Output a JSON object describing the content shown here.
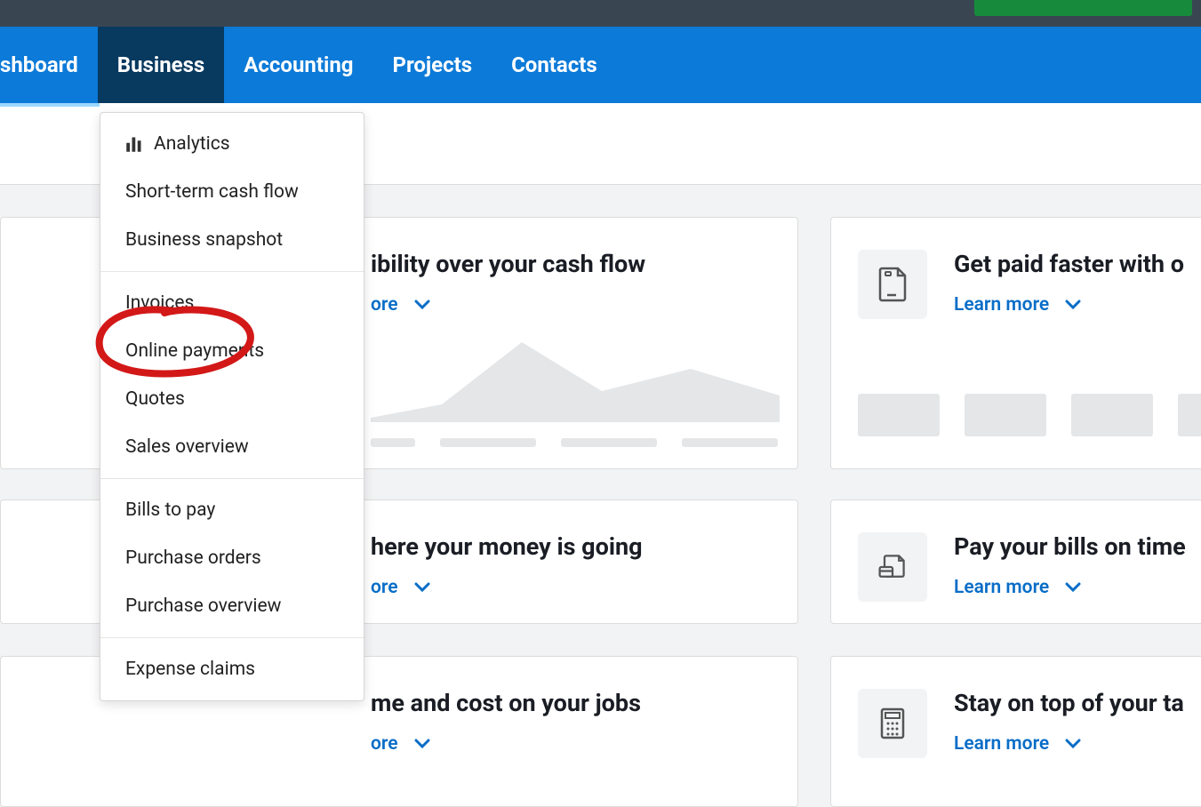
{
  "nav": {
    "dashboard": "shboard",
    "business": "Business",
    "accounting": "Accounting",
    "projects": "Projects",
    "contacts": "Contacts"
  },
  "dropdown": {
    "section1": {
      "analytics": "Analytics",
      "cashflow": "Short-term cash flow",
      "snapshot": "Business snapshot"
    },
    "section2": {
      "invoices": "Invoices",
      "online_payments": "Online payments",
      "quotes": "Quotes",
      "sales_overview": "Sales overview"
    },
    "section3": {
      "bills": "Bills to pay",
      "purchase_orders": "Purchase orders",
      "purchase_overview": "Purchase overview"
    },
    "section4": {
      "expense_claims": "Expense claims"
    }
  },
  "cards": {
    "cashflow": {
      "title": "ibility over your cash flow",
      "learn": "ore"
    },
    "paid": {
      "title": "Get paid faster with o",
      "learn": "Learn more"
    },
    "money": {
      "title": "here your money is going",
      "learn": "ore"
    },
    "bills": {
      "title": "Pay your bills on time",
      "learn": "Learn more"
    },
    "jobs": {
      "title": "me and cost on your jobs",
      "learn": "ore"
    },
    "tax": {
      "title": "Stay on top of your ta",
      "learn": "Learn more"
    }
  }
}
